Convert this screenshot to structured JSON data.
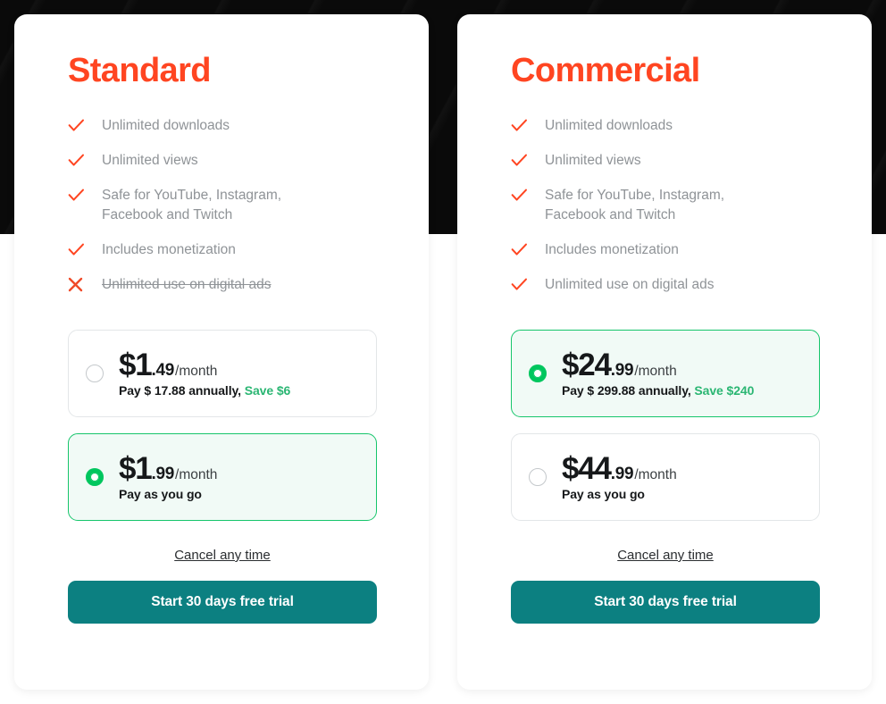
{
  "theme": {
    "accent_title": "#ff4521",
    "check_icon_color": "#ff4521",
    "cross_icon_color": "#f04a28",
    "selected_border": "#16c56b",
    "selected_background": "#f1faf6",
    "radio_selected": "#00c65e",
    "save_text": "#2bb673",
    "cta_background": "#0c8081",
    "feature_text": "#8f9397",
    "backdrop_dark": "#0a0a0a"
  },
  "plans": [
    {
      "title": "Standard",
      "features": [
        {
          "label": "Unlimited downloads",
          "included": true,
          "icon": "check-icon"
        },
        {
          "label": "Unlimited views",
          "included": true,
          "icon": "check-icon"
        },
        {
          "label": "Safe for YouTube, Instagram, Facebook and Twitch",
          "included": true,
          "icon": "check-icon"
        },
        {
          "label": "Includes monetization",
          "included": true,
          "icon": "check-icon"
        },
        {
          "label": "Unlimited use on digital ads",
          "included": false,
          "icon": "cross-icon"
        }
      ],
      "price_options": [
        {
          "amount": "$1",
          "cents": ".49",
          "period": "/month",
          "sub_text": "Pay $ 17.88 annually, ",
          "save_text": "Save $6",
          "selected": false
        },
        {
          "amount": "$1",
          "cents": ".99",
          "period": "/month",
          "sub_text": "Pay as you go",
          "save_text": "",
          "selected": true
        }
      ],
      "cancel_label": "Cancel any time",
      "cta_label": "Start 30 days free trial"
    },
    {
      "title": "Commercial",
      "features": [
        {
          "label": "Unlimited downloads",
          "included": true,
          "icon": "check-icon"
        },
        {
          "label": "Unlimited views",
          "included": true,
          "icon": "check-icon"
        },
        {
          "label": "Safe for YouTube, Instagram, Facebook and Twitch",
          "included": true,
          "icon": "check-icon"
        },
        {
          "label": "Includes monetization",
          "included": true,
          "icon": "check-icon"
        },
        {
          "label": "Unlimited use on digital ads",
          "included": true,
          "icon": "check-icon"
        }
      ],
      "price_options": [
        {
          "amount": "$24",
          "cents": ".99",
          "period": "/month",
          "sub_text": "Pay $ 299.88 annually, ",
          "save_text": "Save $240",
          "selected": true
        },
        {
          "amount": "$44",
          "cents": ".99",
          "period": "/month",
          "sub_text": "Pay as you go",
          "save_text": "",
          "selected": false
        }
      ],
      "cancel_label": "Cancel any time",
      "cta_label": "Start 30 days free trial"
    }
  ]
}
